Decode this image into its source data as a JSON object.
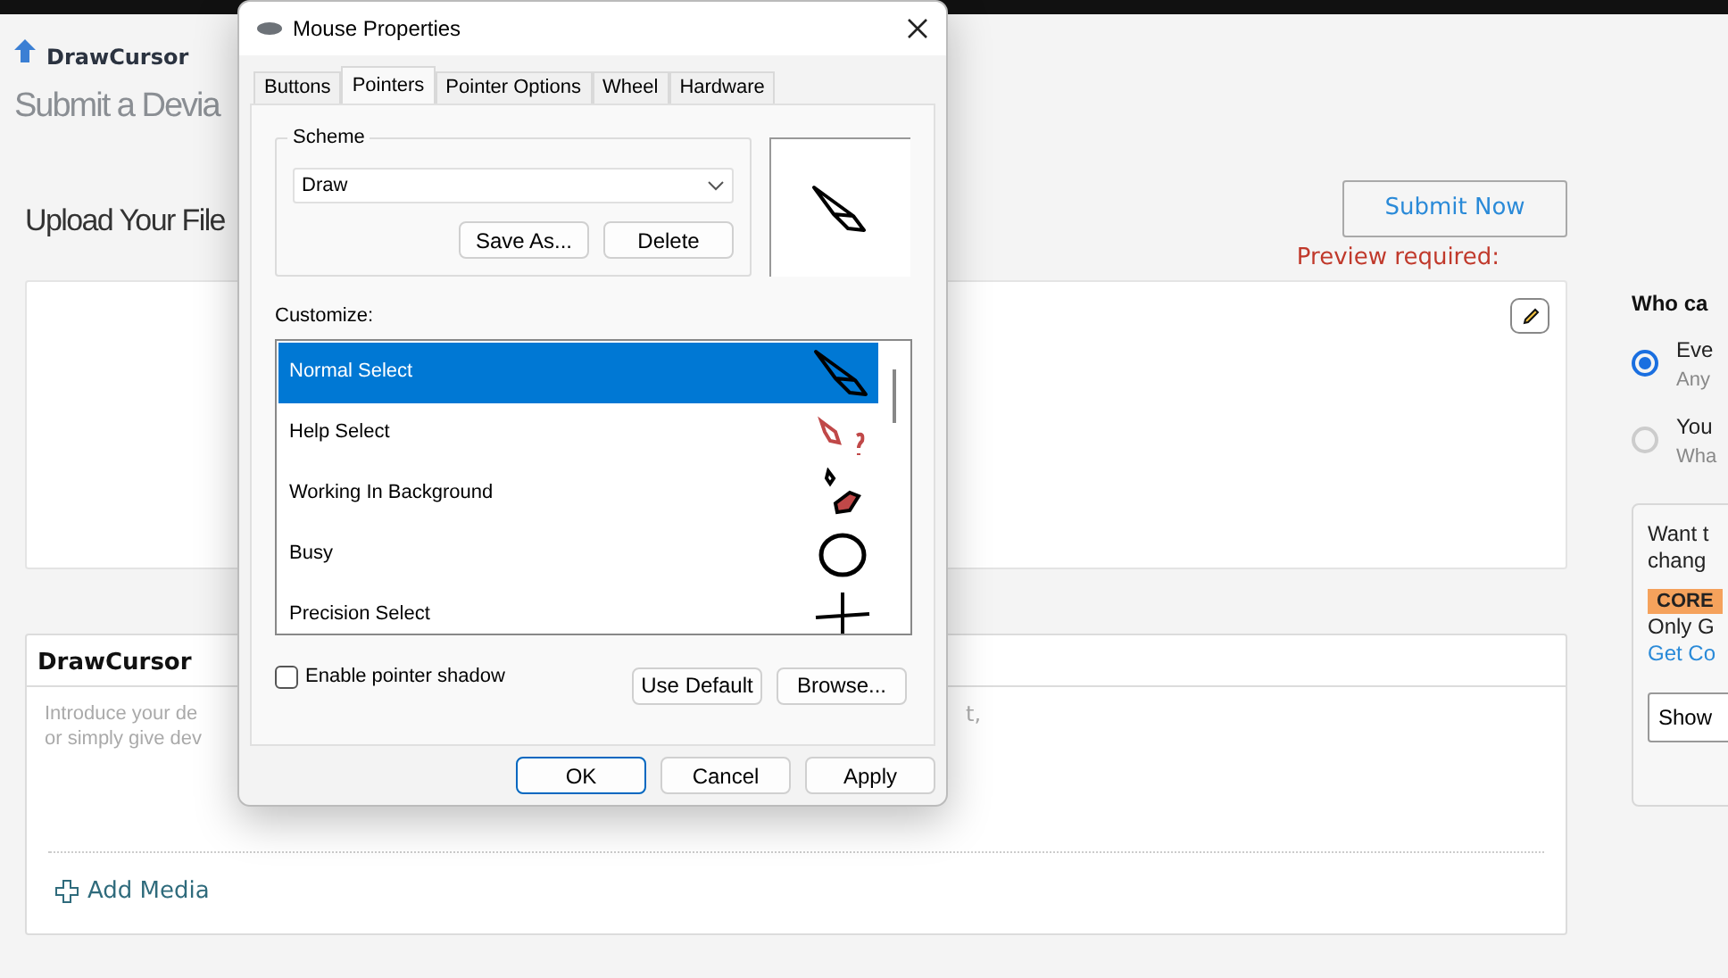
{
  "page": {
    "site_title": "DrawCursor",
    "heading": "Submit a Devia",
    "upload_title": "Upload Your File",
    "submit_button": "Submit Now",
    "preview_warning": "Preview required:",
    "editor": {
      "title": "DrawCursor",
      "placeholder_lines": [
        "Introduce your de",
        "or simply give dev"
      ],
      "placeholder_right": "t,",
      "add_media": "Add Media"
    },
    "sidebar": {
      "heading": "Who ca",
      "options": [
        {
          "label": "Eve",
          "hint": "Any",
          "selected": true
        },
        {
          "label": "You",
          "hint": "Wha",
          "selected": false
        }
      ],
      "promo": {
        "lines": [
          "Want t",
          "chang"
        ],
        "badge": "CORE",
        "note": "Only G",
        "link": "Get Co",
        "button": "Show"
      }
    }
  },
  "dialog": {
    "title": "Mouse Properties",
    "tabs": [
      {
        "label": "Buttons",
        "selected": false
      },
      {
        "label": "Pointers",
        "selected": true
      },
      {
        "label": "Pointer Options",
        "selected": false
      },
      {
        "label": "Wheel",
        "selected": false
      },
      {
        "label": "Hardware",
        "selected": false
      }
    ],
    "scheme": {
      "label": "Scheme",
      "value": "Draw",
      "buttons": [
        "Save As...",
        "Delete"
      ]
    },
    "customize_label": "Customize:",
    "pointers": [
      {
        "label": "Normal Select",
        "kind": "normal",
        "selected": true
      },
      {
        "label": "Help Select",
        "kind": "help",
        "selected": false
      },
      {
        "label": "Working In Background",
        "kind": "working",
        "selected": false
      },
      {
        "label": "Busy",
        "kind": "busy",
        "selected": false
      },
      {
        "label": "Precision Select",
        "kind": "precision",
        "selected": false
      }
    ],
    "shadow": {
      "label": "Enable pointer shadow",
      "checked": false
    },
    "list_buttons": [
      "Use Default",
      "Browse..."
    ],
    "buttons": [
      "OK",
      "Cancel",
      "Apply"
    ]
  }
}
